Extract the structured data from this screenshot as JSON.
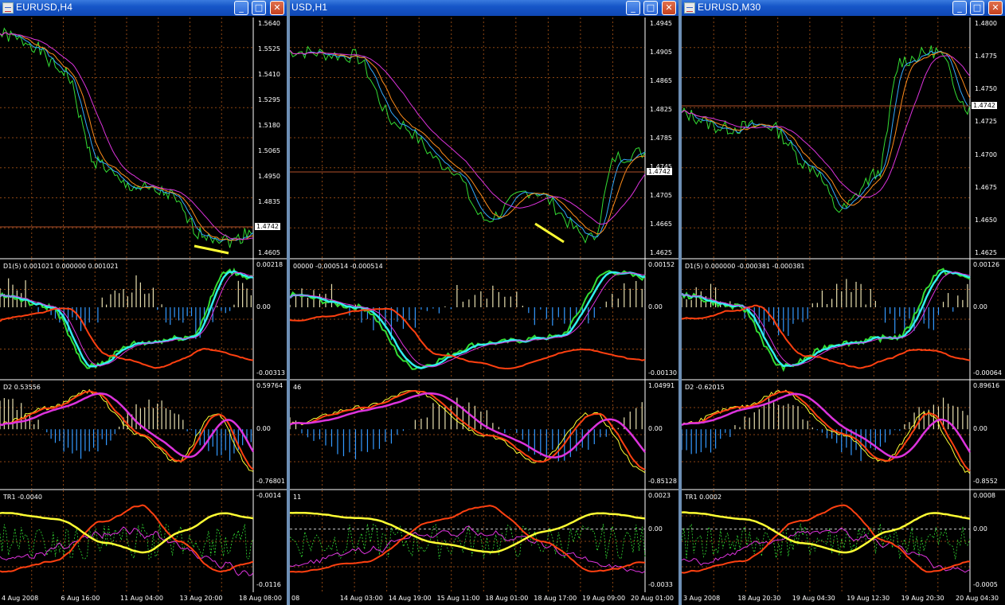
{
  "windows": [
    {
      "title": "EURUSD,H4",
      "main_axis": [
        "1.5640",
        "1.5525",
        "1.5410",
        "1.5295",
        "1.5180",
        "1.5065",
        "1.4950",
        "1.4835",
        "1.4720",
        "1.4605"
      ],
      "price": "1.4742",
      "ind1_label": "D1(5) 0.001021 0.000000 0.001021",
      "ind1_axis": [
        "0.00218",
        "0.00",
        "-0.00313"
      ],
      "ind2_label": "D2 0.53556",
      "ind2_axis": [
        "0.59764",
        "0.00",
        "-0.76801"
      ],
      "ind3_label": "TR1 -0.0040",
      "ind3_axis": [
        "-0.0014",
        "-0.0116"
      ],
      "xaxis": [
        "4 Aug 2008",
        "6 Aug 16:00",
        "11 Aug 04:00",
        "13 Aug 20:00",
        "18 Aug 08:00"
      ]
    },
    {
      "title": "USD,H1",
      "main_axis": [
        "1.4945",
        "1.4905",
        "1.4865",
        "1.4825",
        "1.4785",
        "1.4745",
        "1.4705",
        "1.4665",
        "1.4625"
      ],
      "price": "1.4742",
      "ind1_label": "00000 -0.000514 -0.000514",
      "ind1_axis": [
        "0.00152",
        "0.00",
        "-0.00130"
      ],
      "ind2_label": "46",
      "ind2_axis": [
        "1.04991",
        "0.00",
        "-0.85128"
      ],
      "ind3_label": "11",
      "ind3_axis": [
        "0.0023",
        "0.00",
        "-0.0033"
      ],
      "xaxis": [
        "08",
        "14 Aug 03:00",
        "14 Aug 19:00",
        "15 Aug 11:00",
        "18 Aug 01:00",
        "18 Aug 17:00",
        "19 Aug 09:00",
        "20 Aug 01:00"
      ]
    },
    {
      "title": "EURUSD,M30",
      "main_axis": [
        "1.4800",
        "1.4775",
        "1.4750",
        "1.4725",
        "1.4700",
        "1.4675",
        "1.4650",
        "1.4625"
      ],
      "price": "1.4742",
      "ind1_label": "D1(5) 0.000000 -0.000381 -0.000381",
      "ind1_axis": [
        "0.00126",
        "0.00",
        "-0.00064"
      ],
      "ind2_label": "D2 -0.62015",
      "ind2_axis": [
        "0.89616",
        "0.00",
        "-0.8552"
      ],
      "ind3_label": "TR1 0.0002",
      "ind3_axis": [
        "0.0008",
        "0.00",
        "-0.0005"
      ],
      "xaxis": [
        "3 Aug 2008",
        "18 Aug 20:30",
        "19 Aug 04:30",
        "19 Aug 12:30",
        "19 Aug 20:30",
        "20 Aug 04:30"
      ]
    }
  ],
  "colors": {
    "grid": "#8b4513",
    "green": "#33dd33",
    "blue": "#33aaff",
    "orange": "#ff8c1a",
    "magenta": "#dd33dd",
    "yellow": "#ffff33",
    "red": "#ff4010",
    "cyan": "#33eeee",
    "hist_pos": "#e8e0b0",
    "hist_neg": "#3399ff"
  },
  "buttons": {
    "minimize": "_",
    "maximize": "□",
    "close": "✕"
  }
}
